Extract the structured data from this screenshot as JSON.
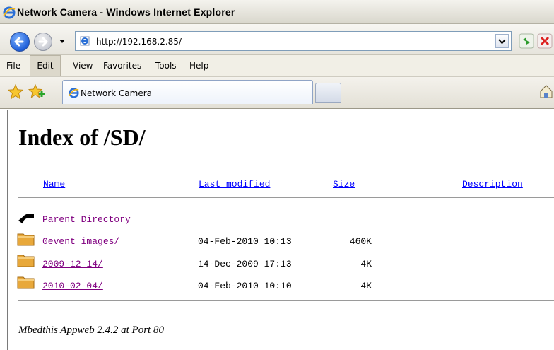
{
  "window": {
    "title": "Network Camera - Windows Internet Explorer"
  },
  "address_bar": {
    "url": "http://192.168.2.85/"
  },
  "menu": {
    "items": [
      "File",
      "Edit",
      "View",
      "Favorites",
      "Tools",
      "Help"
    ],
    "active": "Edit"
  },
  "tabs": [
    {
      "label": "Network Camera"
    }
  ],
  "page": {
    "heading": "Index of /SD/",
    "columns": {
      "name": "Name",
      "modified": "Last modified",
      "size": "Size",
      "description": "Description"
    },
    "rows": [
      {
        "name": "Parent Directory",
        "modified": "",
        "size": "",
        "icon": "back-arrow-icon"
      },
      {
        "name": "0event_images/",
        "modified": "04-Feb-2010 10:13",
        "size": "460K",
        "icon": "folder-icon"
      },
      {
        "name": "2009-12-14/",
        "modified": "14-Dec-2009 17:13",
        "size": "4K",
        "icon": "folder-icon"
      },
      {
        "name": "2010-02-04/",
        "modified": "04-Feb-2010 10:10",
        "size": "4K",
        "icon": "folder-icon"
      }
    ],
    "footer": "Mbedthis Appweb 2.4.2 at Port 80"
  },
  "colors": {
    "link": "#0000ff",
    "visited_link": "#800080",
    "folder": "#e8a83a"
  }
}
